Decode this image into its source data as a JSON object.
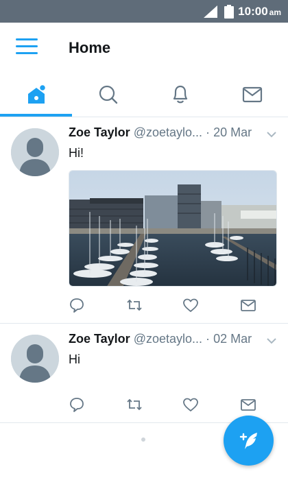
{
  "status_bar": {
    "time": "10:00",
    "ampm": "am"
  },
  "app_bar": {
    "title": "Home"
  },
  "tabs": [
    {
      "name": "home",
      "icon": "home-icon",
      "active": true
    },
    {
      "name": "search",
      "icon": "search-icon",
      "active": false
    },
    {
      "name": "notifications",
      "icon": "bell-icon",
      "active": false
    },
    {
      "name": "messages",
      "icon": "mail-icon",
      "active": false
    }
  ],
  "tweets": [
    {
      "name": "Zoe Taylor",
      "handle": "@zoetaylo...",
      "separator": "·",
      "date": "20 Mar",
      "text": "Hi!",
      "has_media": true
    },
    {
      "name": "Zoe Taylor",
      "handle": "@zoetaylo...",
      "separator": "·",
      "date": "02 Mar",
      "text": "Hi",
      "has_media": false
    }
  ],
  "colors": {
    "accent": "#1da1f2",
    "status_bar": "#5f6c79",
    "secondary_text": "#657786"
  }
}
